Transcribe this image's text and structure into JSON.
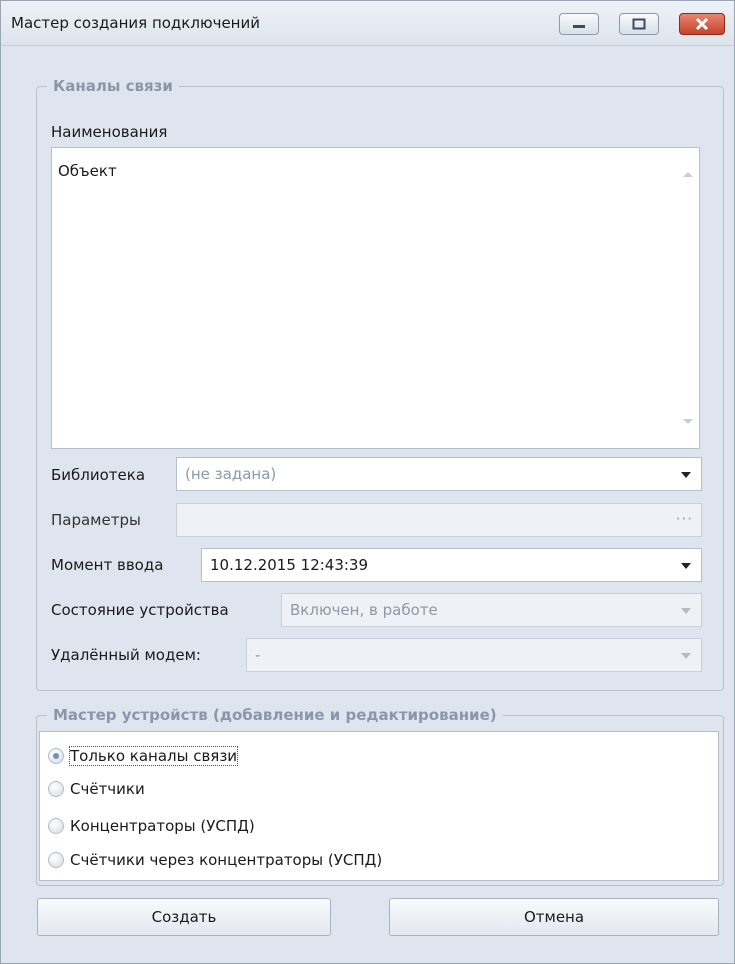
{
  "window": {
    "title": "Мастер создания подключений",
    "close_color": "#c4442d"
  },
  "channels": {
    "legend": "Каналы связи",
    "names_label": "Наименования",
    "names_value": "Объект",
    "library_label": "Библиотека",
    "library_value": "(не задана)",
    "params_label": "Параметры",
    "params_value": "",
    "params_button": "···",
    "moment_label": "Момент ввода",
    "moment_value": "10.12.2015 12:43:39",
    "state_label": "Состояние устройства",
    "state_value": "Включен, в работе",
    "modem_label": "Удалённый модем:",
    "modem_value": "-"
  },
  "wizard": {
    "legend": "Мастер устройств (добавление и редактирование)",
    "options": [
      {
        "label": "Только каналы связи",
        "checked": true
      },
      {
        "label": "Счётчики",
        "checked": false
      },
      {
        "label": "Концентраторы (УСПД)",
        "checked": false
      },
      {
        "label": "Счётчики через концентраторы (УСПД)",
        "checked": false
      }
    ]
  },
  "buttons": {
    "create": "Создать",
    "cancel": "Отмена"
  }
}
